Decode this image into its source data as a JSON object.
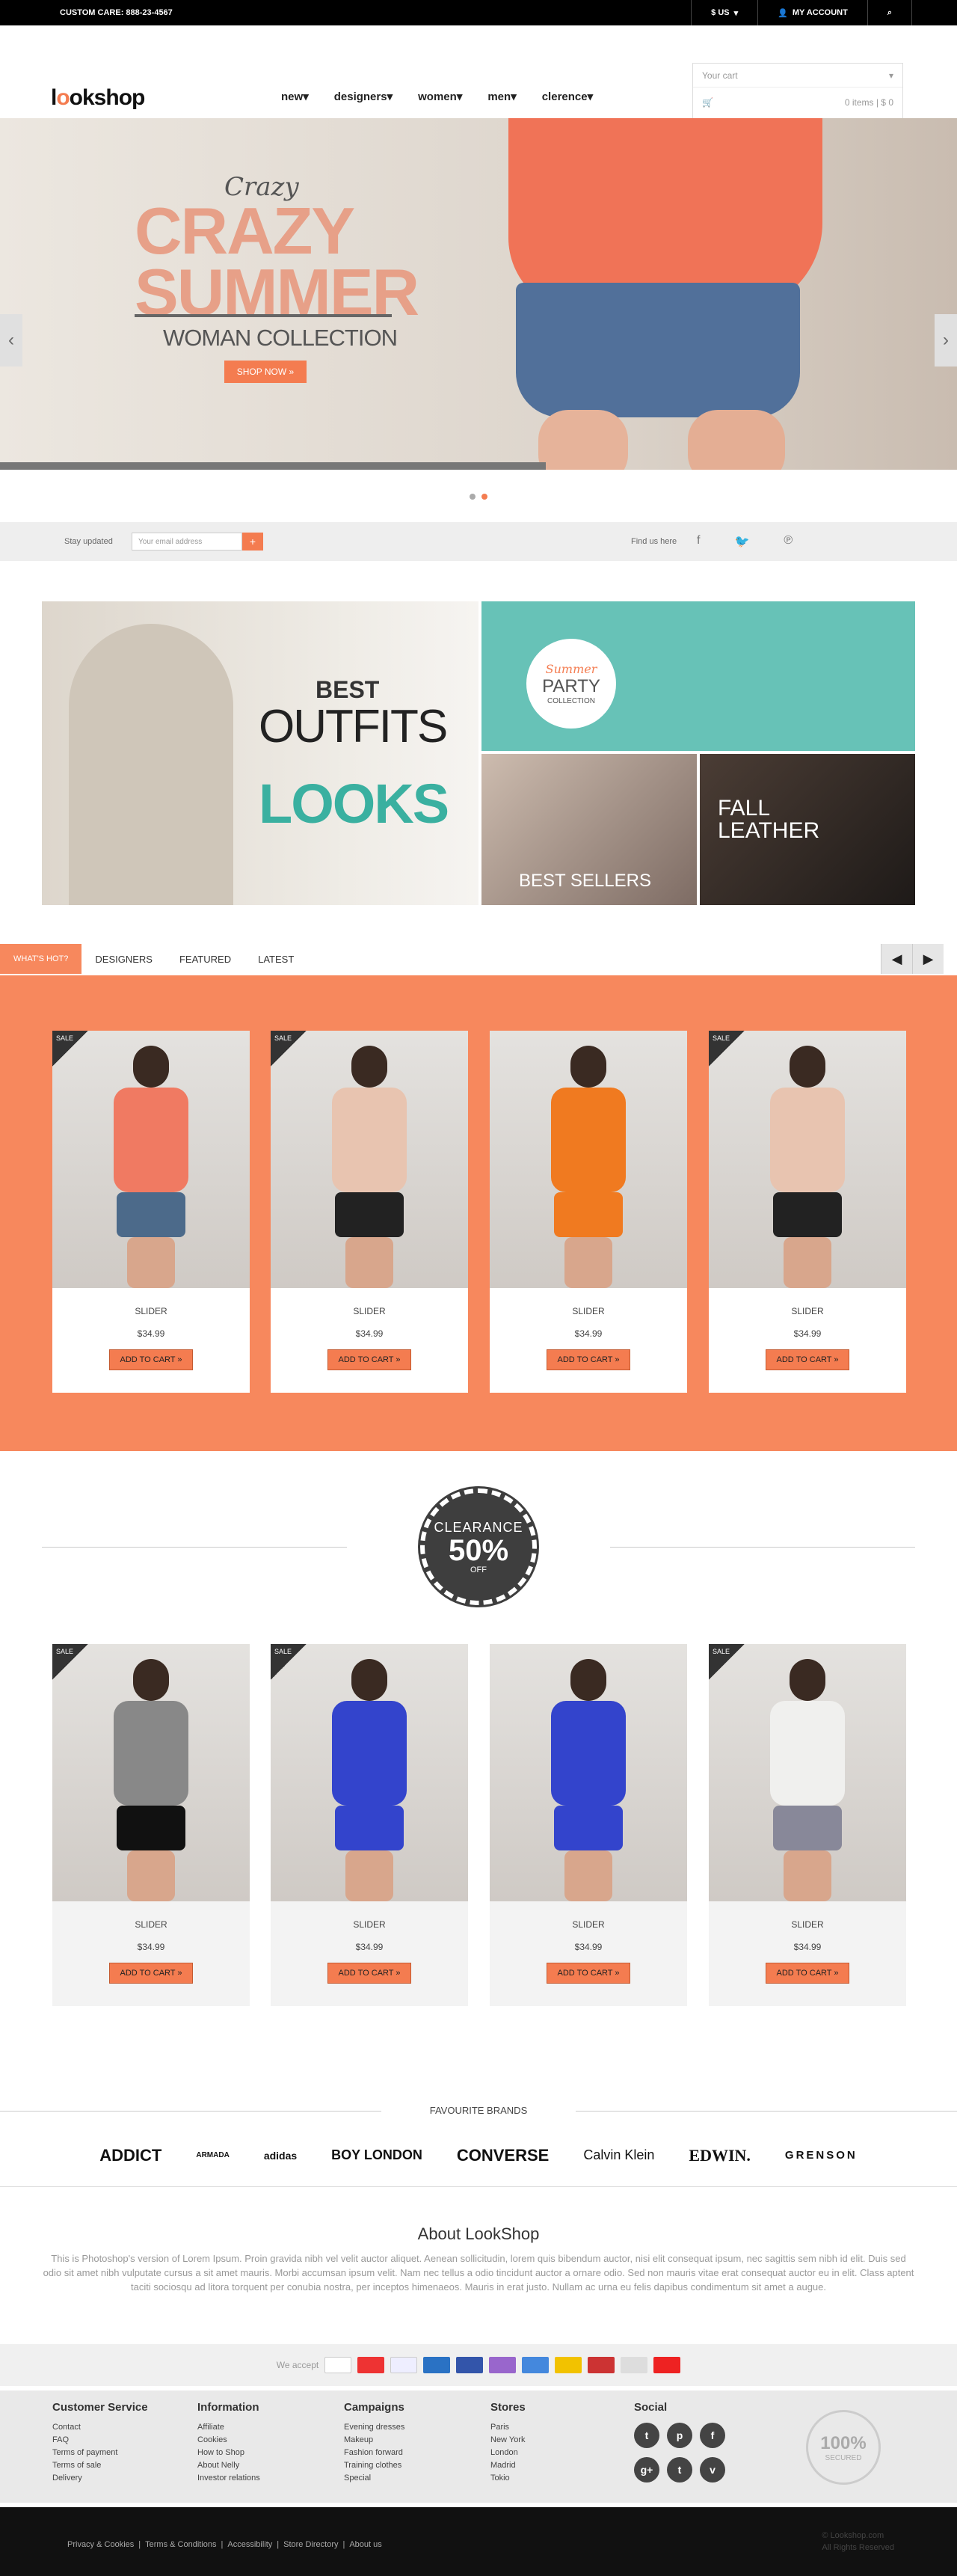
{
  "topbar": {
    "care": "CUSTOM CARE: 888-23-4567",
    "currency": "$ US",
    "account": "MY ACCOUNT",
    "search_icon": "search-icon"
  },
  "header": {
    "logo": "lookshop",
    "nav": [
      "new",
      "designers",
      "women",
      "men",
      "clerence"
    ]
  },
  "cart": {
    "placeholder": "Your cart",
    "summary": "0 items | $ 0"
  },
  "hero": {
    "small": "Crazy",
    "big1": "CRAZY",
    "big2": "SUMMER",
    "sub": "WOMAN COLLECTION",
    "cta": "SHOP NOW »",
    "progress": 0.57
  },
  "newsletter": {
    "label": "Stay updated",
    "placeholder": "Your email address",
    "find": "Find us here"
  },
  "banners": {
    "best": "BEST",
    "outfits": "OUTFITS",
    "looks": "LOOKS",
    "party_s": "Summer",
    "party_p": "PARTY",
    "party_c": "COLLECTION",
    "best_sellers": "BEST SELLERS",
    "fall": "FALL",
    "leather": "LEATHER"
  },
  "tabs": [
    "WHAT'S HOT?",
    "DESIGNERS",
    "FEATURED",
    "LATEST"
  ],
  "hot_products": [
    {
      "name": "SLIDER",
      "price": "$34.99",
      "btn": "ADD TO CART »",
      "sale": "SALE"
    },
    {
      "name": "SLIDER",
      "price": "$34.99",
      "btn": "ADD TO CART »",
      "sale": "SALE"
    },
    {
      "name": "SLIDER",
      "price": "$34.99",
      "btn": "ADD TO CART »",
      "sale": ""
    },
    {
      "name": "SLIDER",
      "price": "$34.99",
      "btn": "ADD TO CART »",
      "sale": "SALE"
    }
  ],
  "clearance": {
    "a": "CLEARANCE",
    "b": "50%",
    "c": "OFF"
  },
  "clear_products": [
    {
      "name": "SLIDER",
      "price": "$34.99",
      "btn": "ADD TO CART »",
      "sale": "SALE"
    },
    {
      "name": "SLIDER",
      "price": "$34.99",
      "btn": "ADD TO CART »",
      "sale": "SALE"
    },
    {
      "name": "SLIDER",
      "price": "$34.99",
      "btn": "ADD TO CART »",
      "sale": ""
    },
    {
      "name": "SLIDER",
      "price": "$34.99",
      "btn": "ADD TO CART »",
      "sale": "SALE"
    }
  ],
  "brands": {
    "title": "FAVOURITE BRANDS",
    "list": [
      "ADDICT",
      "ARMADA",
      "adidas",
      "BOY LONDON",
      "CONVERSE",
      "Calvin Klein",
      "EDWIN.",
      "GRENSON"
    ]
  },
  "about": {
    "title": "About LookShop",
    "text": "This is Photoshop's version of Lorem Ipsum. Proin gravida nibh vel velit auctor aliquet. Aenean sollicitudin, lorem quis bibendum auctor, nisi elit consequat ipsum, nec sagittis sem nibh id elit. Duis sed odio sit amet nibh vulputate cursus a sit amet mauris. Morbi accumsan ipsum velit. Nam nec tellus a odio tincidunt auctor a ornare odio. Sed non mauris vitae erat consequat auctor eu in elit. Class aptent taciti sociosqu ad litora torquent per conubia nostra, per inceptos himenaeos. Mauris in erat justo. Nullam ac urna eu felis dapibus condimentum sit amet a augue."
  },
  "pay": {
    "label": "We accept",
    "cards": [
      "VISA",
      "MC",
      "PayPal",
      "AMEX",
      "Maestro",
      "Card",
      "Card",
      "Card",
      "Card",
      "Card",
      "DK"
    ]
  },
  "footer": {
    "customer_service": {
      "title": "Customer Service",
      "items": [
        "Contact",
        "FAQ",
        "Terms of payment",
        "Terms of sale",
        "Delivery"
      ]
    },
    "information": {
      "title": "Information",
      "items": [
        "Affiliate",
        "Cookies",
        "How to Shop",
        "About Nelly",
        "Investor relations"
      ]
    },
    "campaigns": {
      "title": "Campaigns",
      "items": [
        "Evening dresses",
        "Makeup",
        "Fashion forward",
        "Training clothes",
        "Special"
      ]
    },
    "stores": {
      "title": "Stores",
      "items": [
        "Paris",
        "New York",
        "London",
        "Madrid",
        "Tokio"
      ]
    },
    "social": {
      "title": "Social"
    },
    "secured": {
      "a": "100%",
      "b": "SECURED"
    }
  },
  "bottom": {
    "links": [
      "Privacy & Cookies",
      "Terms & Conditions",
      "Accessibility",
      "Store Directory",
      "About us"
    ],
    "copy1": "© Lookshop.com",
    "copy2": "All Rights Reserved"
  }
}
